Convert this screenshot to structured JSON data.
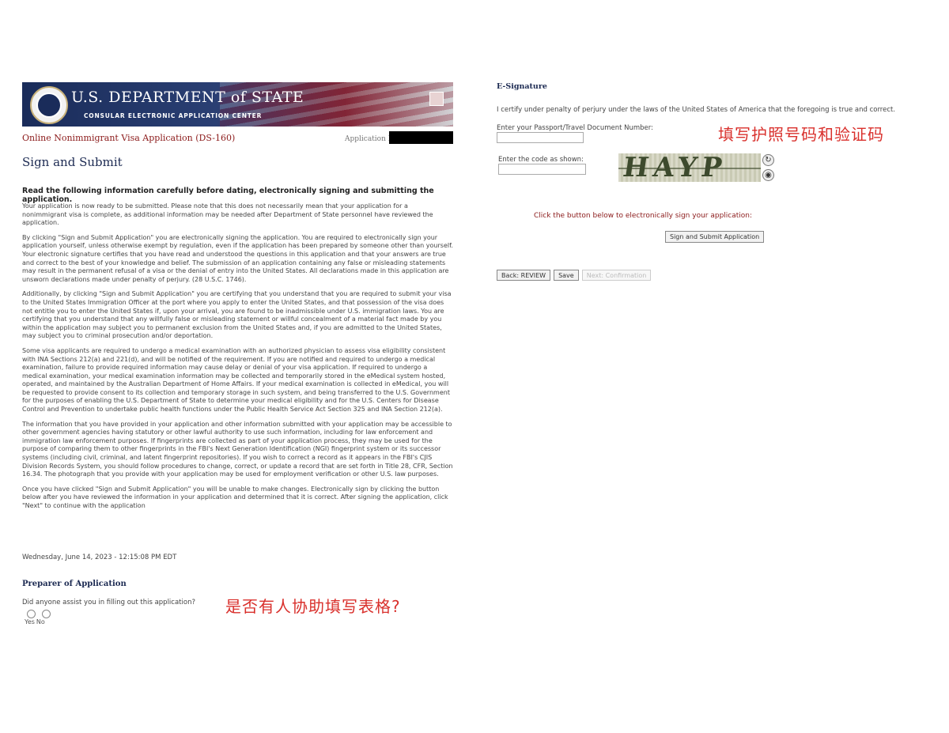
{
  "banner": {
    "title": "U.S. DEPARTMENT of STATE",
    "subtitle": "CONSULAR ELECTRONIC APPLICATION CENTER"
  },
  "header": {
    "application_name": "Online Nonimmigrant Visa Application (DS-160)",
    "application_id_label": "Application ID"
  },
  "page_title": "Sign and Submit",
  "intro_heading": "Read the following information carefully before dating, electronically signing and submitting the application.",
  "paragraphs": [
    "Your application is now ready to be submitted. Please note that this does not necessarily mean that your application for a nonimmigrant visa is complete, as additional information may be needed after Department of State personnel have reviewed the application.",
    "By clicking \"Sign and Submit Application\" you are electronically signing the application. You are required to electronically sign your application yourself, unless otherwise exempt by regulation, even if the application has been prepared by someone other than yourself. Your electronic signature certifies that you have read and understood the questions in this application and that your answers are true and correct to the best of your knowledge and belief. The submission of an application containing any false or misleading statements may result in the permanent refusal of a visa or the denial of entry into the United States. All declarations made in this application are unsworn declarations made under penalty of perjury. (28 U.S.C. 1746).",
    "Additionally, by clicking \"Sign and Submit Application\" you are certifying that you understand that you are required to submit your visa to the United States Immigration Officer at the port where you apply to enter the United States, and that possession of the visa does not entitle you to enter the United States if, upon your arrival, you are found to be inadmissible under U.S. immigration laws. You are certifying that you understand that any willfully false or misleading statement or willful concealment of a material fact made by you within the application may subject you to permanent exclusion from the United States and, if you are admitted to the United States, may subject you to criminal prosecution and/or deportation.",
    "Some visa applicants are required to undergo a medical examination with an authorized physician to assess visa eligibility consistent with INA Sections 212(a) and 221(d), and will be notified of the requirement. If you are notified and required to undergo a medical examination, failure to provide required information may cause delay or denial of your visa application. If required to undergo a medical examination, your medical examination information may be collected and temporarily stored in the eMedical system hosted, operated, and maintained by the Australian Department of Home Affairs. If your medical examination is collected in eMedical, you will be requested to provide consent to its collection and temporary storage in such system, and being transferred to the U.S. Government for the purposes of enabling the U.S. Department of State to determine your medical eligibility and for the U.S. Centers for Disease Control and Prevention to undertake public health functions under the Public Health Service Act Section 325 and INA Section 212(a).",
    "The information that you have provided in your application and other information submitted with your application may be accessible to other government agencies having statutory or other lawful authority to use such information, including for law enforcement and immigration law enforcement purposes. If fingerprints are collected as part of your application process, they may be used for the purpose of comparing them to other fingerprints in the FBI's Next Generation Identification (NGI) fingerprint system or its successor systems (including civil, criminal, and latent fingerprint repositories). If you wish to correct a record as it appears in the FBI's CJIS Division Records System, you should follow procedures to change, correct, or update a record that are set forth in Title 28, CFR, Section 16.34. The photograph that you provide with your application may be used for employment verification or other U.S. law purposes.",
    "Once you have clicked \"Sign and Submit Application\" you will be unable to make changes. Electronically sign by clicking the button below after you have reviewed the information in your application and determined that it is correct. After signing the application, click \"Next\" to continue with the application"
  ],
  "datetime": "Wednesday, June 14, 2023 - 12:15:08 PM EDT",
  "preparer": {
    "title": "Preparer of Application",
    "question": "Did anyone assist you in filling out this application?",
    "options": [
      "Yes",
      "No"
    ]
  },
  "annotations": {
    "left": "是否有人协助填写表格?",
    "right": "填写护照号码和验证码"
  },
  "esignature": {
    "title": "E-Signature",
    "certify": "I certify under penalty of perjury under the laws of the United States of America that the foregoing is true and correct.",
    "passport_label": "Enter your Passport/Travel Document Number:",
    "passport_value": "",
    "code_label": "Enter the code as shown:",
    "code_value": "",
    "captcha_text": "HAYP",
    "click_instruction": "Click the button below to electronically sign your application:",
    "sign_button": "Sign and Submit Application"
  },
  "nav": {
    "back": "Back: REVIEW",
    "save": "Save",
    "next": "Next: Confirmation"
  },
  "icons": {
    "refresh": "refresh-icon",
    "audio": "audio-icon"
  },
  "colors": {
    "banner_navy": "#1a2c5a",
    "accent_red": "#8b1a1a",
    "annotation_red": "#d9302c"
  }
}
